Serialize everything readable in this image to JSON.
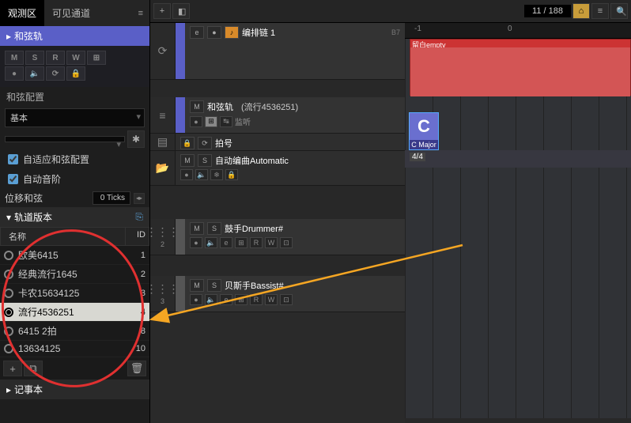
{
  "tabs": {
    "observe": "观测区",
    "visible": "可见通道"
  },
  "inspector": {
    "chord_track": "和弦轨",
    "btns": {
      "m": "M",
      "s": "S",
      "r": "R",
      "w": "W"
    },
    "chord_config": "和弦配置",
    "preset": "基本",
    "auto_chord": "自适应和弦配置",
    "auto_scale": "自动音阶",
    "offset_label": "位移和弦",
    "offset_value": "0 Ticks",
    "track_versions": "轨道版本",
    "col_name": "名称",
    "col_id": "ID",
    "versions": [
      {
        "name": "欧美6415",
        "id": "1"
      },
      {
        "name": "经典流行1645",
        "id": "2"
      },
      {
        "name": "卡农15634125",
        "id": "3"
      },
      {
        "name": "流行4536251",
        "id": "4",
        "selected": true
      },
      {
        "name": "6415 2拍",
        "id": "8"
      },
      {
        "name": "13634125",
        "id": "10"
      }
    ],
    "notes": "记事本"
  },
  "toolbar": {
    "counter": "11 / 188"
  },
  "ruler": {
    "m_neg1": "-1",
    "m_0": "0"
  },
  "tracks": {
    "link_chain": {
      "title": "编排链 1",
      "key": "B7"
    },
    "chord": {
      "title": "和弦轨",
      "subtitle": "(流行4536251)",
      "monitor": "监听"
    },
    "sig": {
      "title": "拍号"
    },
    "auto": {
      "title": "自动编曲Automatic"
    },
    "drummer": {
      "title": "鼓手Drummer#"
    },
    "bassist": {
      "title": "贝斯手Bassist#"
    }
  },
  "timeline": {
    "empty_clip": "留白empty",
    "chord_letter": "C",
    "chord_name": "C Major",
    "timesig": "4/4"
  }
}
